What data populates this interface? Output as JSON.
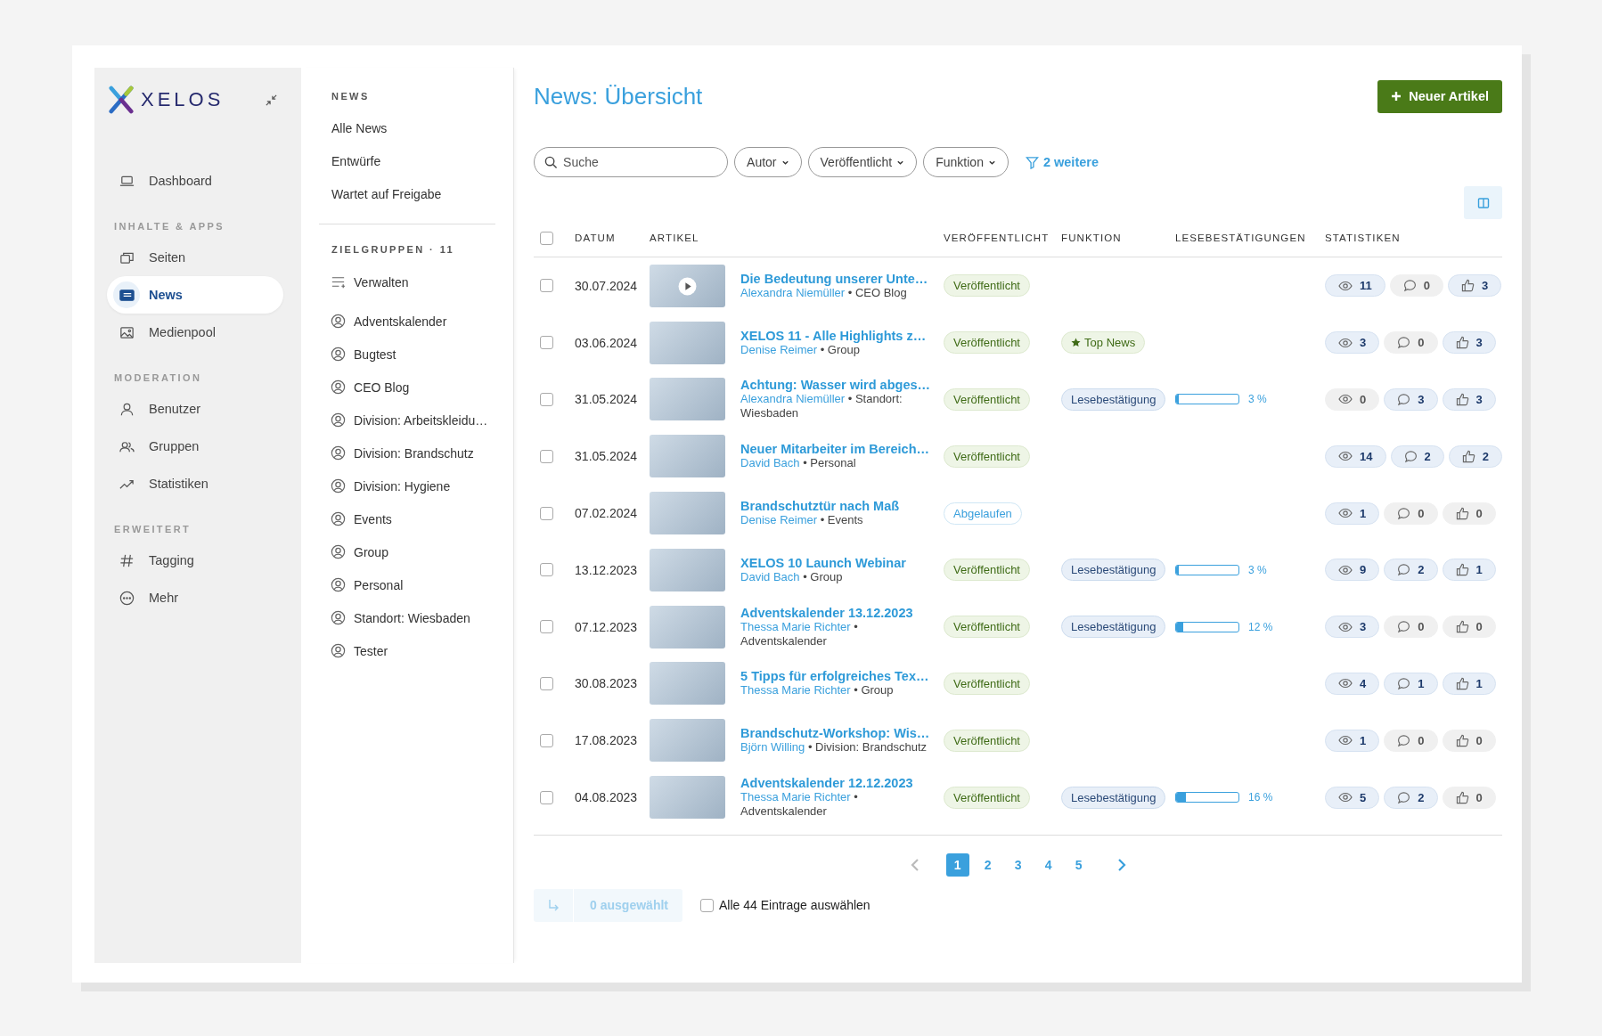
{
  "logo": "XELOS",
  "sidebar": {
    "sections": [
      {
        "items": [
          {
            "label": "Dashboard",
            "selected": false
          }
        ]
      },
      {
        "heading": "INHALTE & APPS",
        "items": [
          {
            "label": "Seiten",
            "selected": false
          },
          {
            "label": "News",
            "selected": true
          },
          {
            "label": "Medienpool",
            "selected": false
          }
        ]
      },
      {
        "heading": "MODERATION",
        "items": [
          {
            "label": "Benutzer",
            "selected": false
          },
          {
            "label": "Gruppen",
            "selected": false
          },
          {
            "label": "Statistiken",
            "selected": false
          }
        ]
      },
      {
        "heading": "ERWEITERT",
        "items": [
          {
            "label": "Tagging",
            "selected": false
          },
          {
            "label": "Mehr",
            "selected": false
          }
        ]
      }
    ]
  },
  "subnav": {
    "heading": "NEWS",
    "items": [
      "Alle News",
      "Entwürfe",
      "Wartet auf Freigabe"
    ],
    "groups_heading": "ZIELGRUPPEN · 11",
    "manage": "Verwalten",
    "groups": [
      "Adventskalender",
      "Bugtest",
      "CEO Blog",
      "Division: Arbeitskleidu…",
      "Division: Brandschutz",
      "Division: Hygiene",
      "Events",
      "Group",
      "Personal",
      "Standort: Wiesbaden",
      "Tester"
    ]
  },
  "title": "News: Übersicht",
  "new_button": "Neuer Artikel",
  "filters": {
    "search_placeholder": "Suche",
    "chips": [
      "Autor",
      "Veröffentlicht",
      "Funktion"
    ],
    "more": "2 weitere"
  },
  "table": {
    "header_checked": false,
    "columns": [
      "DATUM",
      "ARTIKEL",
      "VERÖFFENTLICHT",
      "FUNKTION",
      "LESEBESTÄTIGUNGEN",
      "STATISTIKEN"
    ],
    "rows": [
      {
        "checked": false,
        "date": "30.07.2024",
        "video": true,
        "title": "Die Bedeutung unserer Unte…",
        "author": "Alexandra Niemüller",
        "group": "• CEO Blog",
        "status": {
          "kind": "published",
          "label": "Veröffentlicht"
        },
        "stats": [
          {
            "kind": "views",
            "value": "11",
            "highlighted": true
          },
          {
            "kind": "comments",
            "value": "0",
            "highlighted": false
          },
          {
            "kind": "likes",
            "value": "3",
            "highlighted": true
          }
        ]
      },
      {
        "checked": false,
        "date": "03.06.2024",
        "video": false,
        "title": "XELOS 11 - Alle Highlights z…",
        "author": "Denise Reimer",
        "group": "• Group",
        "status": {
          "kind": "published",
          "label": "Veröffentlicht"
        },
        "function": {
          "kind": "top",
          "label": "Top News"
        },
        "stats": [
          {
            "kind": "views",
            "value": "3",
            "highlighted": true
          },
          {
            "kind": "comments",
            "value": "0",
            "highlighted": false
          },
          {
            "kind": "likes",
            "value": "3",
            "highlighted": true
          }
        ]
      },
      {
        "checked": false,
        "date": "31.05.2024",
        "video": false,
        "title": "Achtung: Wasser wird abges…",
        "author": "Alexandra Niemüller",
        "group": "• Standort: Wiesbaden",
        "status": {
          "kind": "published",
          "label": "Veröffentlicht"
        },
        "function": {
          "kind": "confirmation",
          "label": "Lesebestätigung"
        },
        "progress": {
          "level": 0.03,
          "reading": "3 %"
        },
        "stats": [
          {
            "kind": "views",
            "value": "0",
            "highlighted": false
          },
          {
            "kind": "comments",
            "value": "3",
            "highlighted": true
          },
          {
            "kind": "likes",
            "value": "3",
            "highlighted": true
          }
        ]
      },
      {
        "checked": false,
        "date": "31.05.2024",
        "video": false,
        "title": "Neuer Mitarbeiter im Bereich…",
        "author": "David Bach",
        "group": "• Personal",
        "status": {
          "kind": "published",
          "label": "Veröffentlicht"
        },
        "stats": [
          {
            "kind": "views",
            "value": "14",
            "highlighted": true
          },
          {
            "kind": "comments",
            "value": "2",
            "highlighted": true
          },
          {
            "kind": "likes",
            "value": "2",
            "highlighted": true
          }
        ]
      },
      {
        "checked": false,
        "date": "07.02.2024",
        "video": false,
        "title": "Brandschutztür nach Maß",
        "author": "Denise Reimer",
        "group": "• Events",
        "status": {
          "kind": "expired",
          "label": "Abgelaufen"
        },
        "stats": [
          {
            "kind": "views",
            "value": "1",
            "highlighted": true
          },
          {
            "kind": "comments",
            "value": "0",
            "highlighted": false
          },
          {
            "kind": "likes",
            "value": "0",
            "highlighted": false
          }
        ]
      },
      {
        "checked": false,
        "date": "13.12.2023",
        "video": false,
        "title": "XELOS 10 Launch Webinar",
        "author": "David Bach",
        "group": "• Group",
        "status": {
          "kind": "published",
          "label": "Veröffentlicht"
        },
        "function": {
          "kind": "confirmation",
          "label": "Lesebestätigung"
        },
        "progress": {
          "level": 0.03,
          "reading": "3 %"
        },
        "stats": [
          {
            "kind": "views",
            "value": "9",
            "highlighted": true
          },
          {
            "kind": "comments",
            "value": "2",
            "highlighted": true
          },
          {
            "kind": "likes",
            "value": "1",
            "highlighted": true
          }
        ]
      },
      {
        "checked": false,
        "date": "07.12.2023",
        "video": false,
        "title": "Adventskalender 13.12.2023",
        "author": "Thessa Marie Richter",
        "group": "• Adventskalender",
        "status": {
          "kind": "published",
          "label": "Veröffentlicht"
        },
        "function": {
          "kind": "confirmation",
          "label": "Lesebestätigung"
        },
        "progress": {
          "level": 0.12,
          "reading": "12 %"
        },
        "stats": [
          {
            "kind": "views",
            "value": "3",
            "highlighted": true
          },
          {
            "kind": "comments",
            "value": "0",
            "highlighted": false
          },
          {
            "kind": "likes",
            "value": "0",
            "highlighted": false
          }
        ]
      },
      {
        "checked": false,
        "date": "30.08.2023",
        "video": false,
        "title": "5 Tipps für erfolgreiches Tex…",
        "author": "Thessa Marie Richter",
        "group": "• Group",
        "status": {
          "kind": "published",
          "label": "Veröffentlicht"
        },
        "stats": [
          {
            "kind": "views",
            "value": "4",
            "highlighted": true
          },
          {
            "kind": "comments",
            "value": "1",
            "highlighted": true
          },
          {
            "kind": "likes",
            "value": "1",
            "highlighted": true
          }
        ]
      },
      {
        "checked": false,
        "date": "17.08.2023",
        "video": false,
        "title": "Brandschutz-Workshop: Wis…",
        "author": "Björn Willing",
        "group": "• Division: Brandschutz",
        "status": {
          "kind": "published",
          "label": "Veröffentlicht"
        },
        "stats": [
          {
            "kind": "views",
            "value": "1",
            "highlighted": true
          },
          {
            "kind": "comments",
            "value": "0",
            "highlighted": false
          },
          {
            "kind": "likes",
            "value": "0",
            "highlighted": false
          }
        ]
      },
      {
        "checked": false,
        "date": "04.08.2023",
        "video": false,
        "title": "Adventskalender 12.12.2023",
        "author": "Thessa Marie Richter",
        "group": "• Adventskalender",
        "status": {
          "kind": "published",
          "label": "Veröffentlicht"
        },
        "function": {
          "kind": "confirmation",
          "label": "Lesebestätigung"
        },
        "progress": {
          "level": 0.16,
          "reading": "16 %"
        },
        "stats": [
          {
            "kind": "views",
            "value": "5",
            "highlighted": true
          },
          {
            "kind": "comments",
            "value": "2",
            "highlighted": true
          },
          {
            "kind": "likes",
            "value": "0",
            "highlighted": false
          }
        ]
      }
    ]
  },
  "pagination": {
    "prev_disabled": true,
    "next_disabled": false,
    "pages": [
      {
        "label": "1",
        "selected": true
      },
      {
        "label": "2",
        "selected": false
      },
      {
        "label": "3",
        "selected": false
      },
      {
        "label": "4",
        "selected": false
      },
      {
        "label": "5",
        "selected": false
      }
    ]
  },
  "selection": {
    "count_label": "0 ausgewählt",
    "disabled": true,
    "select_all": "Alle 44 Eintrage auswählen",
    "select_all_checked": false
  }
}
